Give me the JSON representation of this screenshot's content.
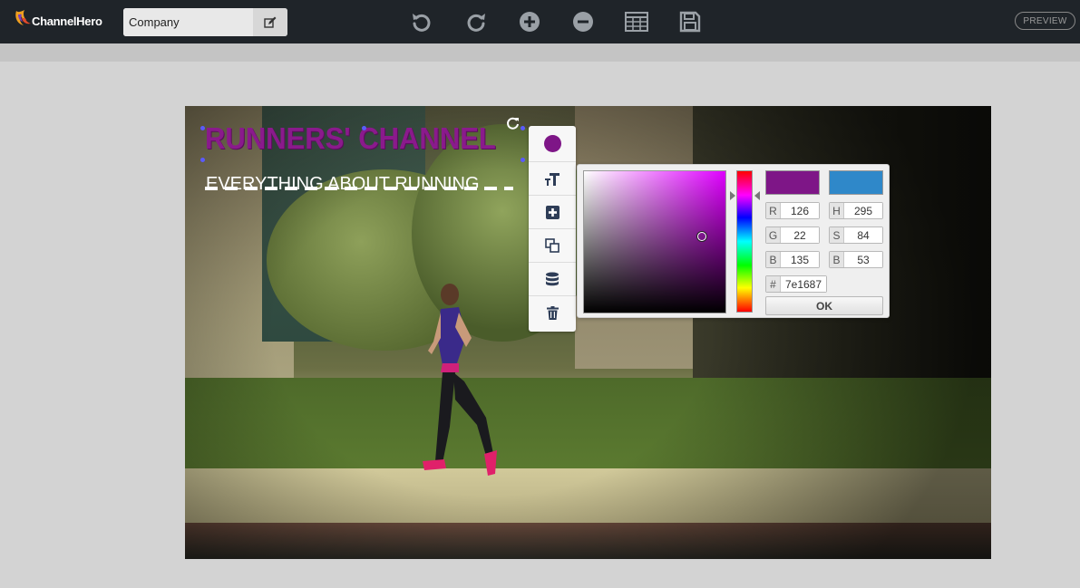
{
  "app": {
    "brand": "ChannelHero",
    "company_value": "Company",
    "preview_label": "PREVIEW"
  },
  "toolbar": {
    "icons": [
      "undo-icon",
      "redo-icon",
      "zoom-in-icon",
      "zoom-out-icon",
      "grid-icon",
      "save-icon"
    ]
  },
  "canvas": {
    "title": "RUNNERS' CHANNEL",
    "subtitle": "EVERYTHING ABOUT RUNNING"
  },
  "side_toolbar": {
    "items": [
      "color-swatch",
      "text-size-icon",
      "add-icon",
      "copy-icon",
      "layers-icon",
      "trash-icon"
    ],
    "current_color": "#7e1687"
  },
  "color_picker": {
    "new_color": "#7e1687",
    "old_color": "#2f88c9",
    "r_label": "R",
    "r": "126",
    "g_label": "G",
    "g": "22",
    "b_label": "B",
    "b": "135",
    "h_label": "H",
    "h": "295",
    "s_label": "S",
    "s": "84",
    "b2_label": "B",
    "b2": "53",
    "hex_label": "#",
    "hex": "7e1687",
    "ok_label": "OK"
  }
}
